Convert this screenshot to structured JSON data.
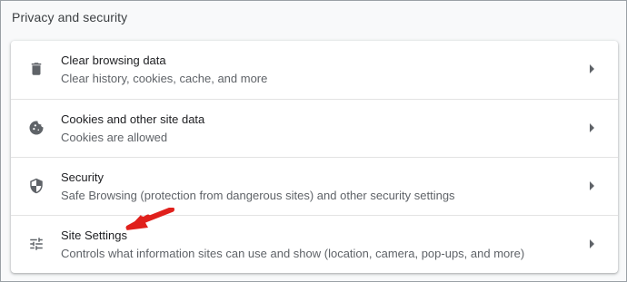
{
  "section": {
    "title": "Privacy and security"
  },
  "rows": [
    {
      "label": "Clear browsing data",
      "sub": "Clear history, cookies, cache, and more",
      "icon": "trash-icon"
    },
    {
      "label": "Cookies and other site data",
      "sub": "Cookies are allowed",
      "icon": "cookie-icon"
    },
    {
      "label": "Security",
      "sub": "Safe Browsing (protection from dangerous sites) and other security settings",
      "icon": "shield-icon"
    },
    {
      "label": "Site Settings",
      "sub": "Controls what information sites can use and show (location, camera, pop-ups, and more)",
      "icon": "tune-sliders-icon"
    }
  ],
  "colors": {
    "annotation_arrow": "#e0201c",
    "icon": "#5f6368",
    "arrow": "#5f6368"
  }
}
